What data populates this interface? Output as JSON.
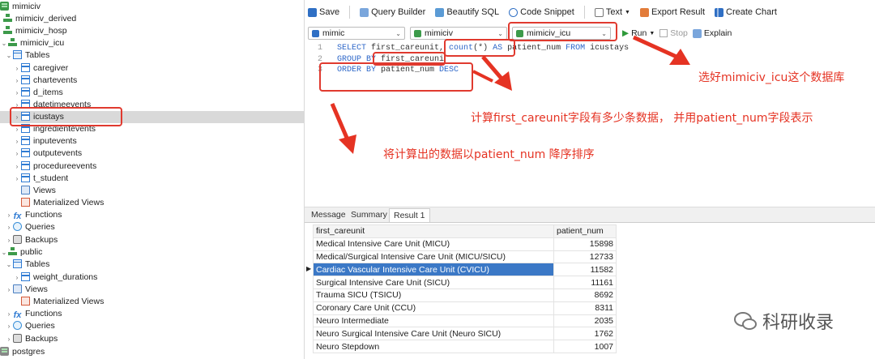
{
  "sidebar": {
    "rows": [
      {
        "label": "mimiciv",
        "icon": "database-icon"
      },
      {
        "label": "mimiciv_derived",
        "icon": "schema-icon"
      },
      {
        "label": "mimiciv_hosp",
        "icon": "schema-icon"
      },
      {
        "label": "mimiciv_icu",
        "icon": "schema-icon"
      },
      {
        "label": "Tables",
        "icon": "tables-icon"
      },
      {
        "label": "caregiver",
        "icon": "table-icon"
      },
      {
        "label": "chartevents",
        "icon": "table-icon"
      },
      {
        "label": "d_items",
        "icon": "table-icon"
      },
      {
        "label": "datetimeevents",
        "icon": "table-icon"
      },
      {
        "label": "icustays",
        "icon": "table-icon"
      },
      {
        "label": "ingredientevents",
        "icon": "table-icon"
      },
      {
        "label": "inputevents",
        "icon": "table-icon"
      },
      {
        "label": "outputevents",
        "icon": "table-icon"
      },
      {
        "label": "procedureevents",
        "icon": "table-icon"
      },
      {
        "label": "t_student",
        "icon": "table-icon"
      },
      {
        "label": "Views",
        "icon": "views-icon"
      },
      {
        "label": "Materialized Views",
        "icon": "materialized-views-icon"
      },
      {
        "label": "Functions",
        "icon": "functions-icon"
      },
      {
        "label": "Queries",
        "icon": "queries-icon"
      },
      {
        "label": "Backups",
        "icon": "backups-icon"
      },
      {
        "label": "public",
        "icon": "schema-icon"
      },
      {
        "label": "Tables",
        "icon": "tables-icon"
      },
      {
        "label": "weight_durations",
        "icon": "table-icon"
      },
      {
        "label": "Views",
        "icon": "views-icon"
      },
      {
        "label": "Materialized Views",
        "icon": "materialized-views-icon"
      },
      {
        "label": "Functions",
        "icon": "functions-icon"
      },
      {
        "label": "Queries",
        "icon": "queries-icon"
      },
      {
        "label": "Backups",
        "icon": "backups-icon"
      },
      {
        "label": "postgres",
        "icon": "database-icon"
      }
    ]
  },
  "toolbar": {
    "save": "Save",
    "query_builder": "Query Builder",
    "beautify": "Beautify SQL",
    "code_snippet": "Code Snippet",
    "text": "Text",
    "export": "Export Result",
    "chart": "Create Chart"
  },
  "connbar": {
    "connection": "mimic",
    "database": "mimiciv",
    "schema": "mimiciv_icu",
    "run": "Run",
    "stop": "Stop",
    "explain": "Explain"
  },
  "editor": {
    "lines": [
      {
        "num": "1",
        "kw1": "SELECT",
        "t1": " first_careunit, ",
        "fn": "count",
        "t2": "(*) ",
        "kw2": "AS",
        "t3": " patient_num ",
        "kw3": "FROM",
        "t4": " icustays"
      },
      {
        "num": "2",
        "kw1": "GROUP BY",
        "t1": " first_careuni"
      },
      {
        "num": "3",
        "kw1": "ORDER BY",
        "t1": " patient_num ",
        "kw2": "DESC"
      }
    ]
  },
  "annotations": {
    "schema": "选好mimiciv_icu这个数据库",
    "count": "计算first_careunit字段有多少条数据， 并用patient_num字段表示",
    "order": "将计算出的数据以patient_num 降序排序"
  },
  "results": {
    "tabs": [
      "Message",
      "Summary",
      "Result 1"
    ],
    "columns": [
      "first_careunit",
      "patient_num"
    ],
    "rows": [
      {
        "unit": "Medical Intensive Care Unit (MICU)",
        "num": "15898"
      },
      {
        "unit": "Medical/Surgical Intensive Care Unit (MICU/SICU)",
        "num": "12733"
      },
      {
        "unit": "Cardiac Vascular Intensive Care Unit (CVICU)",
        "num": "11582"
      },
      {
        "unit": "Surgical Intensive Care Unit (SICU)",
        "num": "11161"
      },
      {
        "unit": "Trauma SICU (TSICU)",
        "num": "8692"
      },
      {
        "unit": "Coronary Care Unit (CCU)",
        "num": "8311"
      },
      {
        "unit": "Neuro Intermediate",
        "num": "2035"
      },
      {
        "unit": "Neuro Surgical Intensive Care Unit (Neuro SICU)",
        "num": "1762"
      },
      {
        "unit": "Neuro Stepdown",
        "num": "1007"
      }
    ]
  },
  "watermark": "科研收录",
  "colors": {
    "annotation": "#e53323",
    "keyword": "#2b65c8",
    "selection": "#3b78c6"
  }
}
